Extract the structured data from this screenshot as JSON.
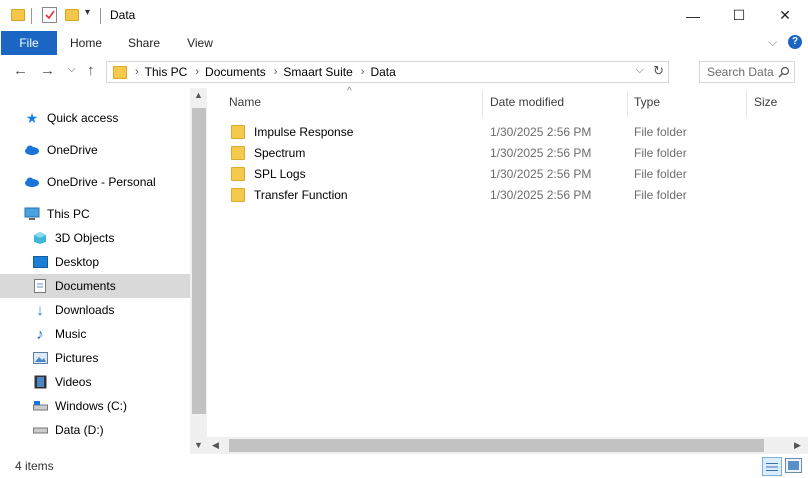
{
  "window": {
    "title": "Data",
    "controls": {
      "minimize": "—",
      "maximize": "☐",
      "close": "✕"
    }
  },
  "ribbon": {
    "tabs": [
      "File",
      "Home",
      "Share",
      "View"
    ]
  },
  "address": {
    "breadcrumbs": [
      "This PC",
      "Documents",
      "Smaart Suite",
      "Data"
    ]
  },
  "search": {
    "placeholder": "Search Data"
  },
  "navigation": {
    "items": [
      {
        "label": "Quick access",
        "icon": "star-icon"
      },
      {
        "label": "OneDrive",
        "icon": "cloud-icon"
      },
      {
        "label": "OneDrive - Personal",
        "icon": "cloud-icon"
      },
      {
        "label": "This PC",
        "icon": "computer-icon"
      },
      {
        "label": "3D Objects",
        "icon": "cube-icon"
      },
      {
        "label": "Desktop",
        "icon": "desktop-icon"
      },
      {
        "label": "Documents",
        "icon": "document-icon",
        "selected": true
      },
      {
        "label": "Downloads",
        "icon": "download-icon"
      },
      {
        "label": "Music",
        "icon": "music-icon"
      },
      {
        "label": "Pictures",
        "icon": "pictures-icon"
      },
      {
        "label": "Videos",
        "icon": "video-icon"
      },
      {
        "label": "Windows (C:)",
        "icon": "drive-icon"
      },
      {
        "label": "Data (D:)",
        "icon": "drive-icon"
      }
    ]
  },
  "columns": [
    "Name",
    "Date modified",
    "Type",
    "Size"
  ],
  "files": [
    {
      "name": "Impulse Response",
      "date": "1/30/2025 2:56 PM",
      "type": "File folder"
    },
    {
      "name": "Spectrum",
      "date": "1/30/2025 2:56 PM",
      "type": "File folder"
    },
    {
      "name": "SPL Logs",
      "date": "1/30/2025 2:56 PM",
      "type": "File folder"
    },
    {
      "name": "Transfer Function",
      "date": "1/30/2025 2:56 PM",
      "type": "File folder"
    }
  ],
  "status": {
    "item_count": "4 items"
  },
  "colors": {
    "accent": "#1a66c2",
    "folder": "#f5c94c",
    "selected": "#d9d9d9"
  }
}
